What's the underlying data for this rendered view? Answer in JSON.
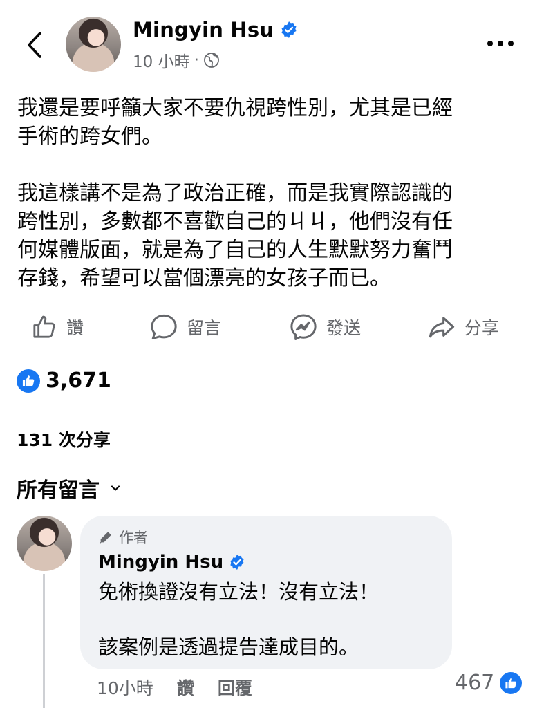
{
  "header": {
    "author_name": "Mingyin Hsu",
    "time": "10 小時",
    "separator": "·"
  },
  "post": {
    "text": "我還是要呼籲大家不要仇視跨性別，尤其是已經\n手術的跨女們。\n\n我這樣講不是為了政治正確，而是我實際認識的\n跨性別，多數都不喜歡自己的ㄐㄐ，他們沒有任\n何媒體版面，就是為了自己的人生默默努力奮鬥\n存錢，希望可以當個漂亮的女孩子而已。"
  },
  "actions": {
    "like": "讚",
    "comment": "留言",
    "send": "發送",
    "share": "分享"
  },
  "stats": {
    "likes": "3,671",
    "shares": "131 次分享"
  },
  "comments_header": "所有留言",
  "comment": {
    "badge": "作者",
    "name": "Mingyin Hsu",
    "text": "免術換證沒有立法！沒有立法！\n\n該案例是透過提告達成目的。",
    "time": "10小時",
    "like": "讚",
    "reply": "回覆",
    "likes": "467"
  },
  "icons": {
    "back": "chevron-left-icon",
    "verified": "verified-badge-icon",
    "audience": "globe-icon",
    "more": "more-horizontal-icon",
    "like": "thumbs-up-icon",
    "comment": "comment-bubble-icon",
    "send": "messenger-icon",
    "share": "share-arrow-icon",
    "dropdown": "chevron-down-icon",
    "author_badge": "pencil-icon"
  },
  "colors": {
    "accent_blue": "#1877f2",
    "secondary_text": "#65676b",
    "bubble_bg": "#f0f2f5"
  }
}
